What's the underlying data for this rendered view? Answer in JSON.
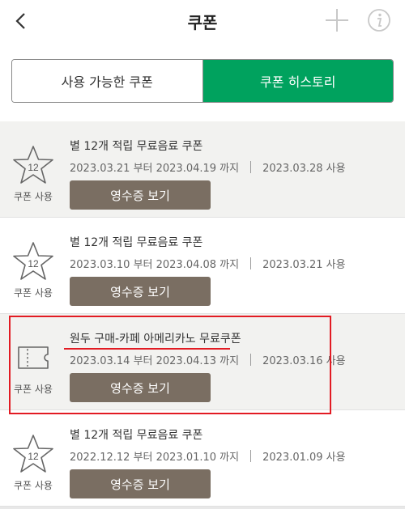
{
  "header": {
    "title": "쿠폰",
    "back_icon": "chevron-left-icon",
    "add_icon": "plus-icon",
    "info_icon": "info-icon"
  },
  "tabs": [
    {
      "label": "사용 가능한 쿠폰",
      "active": false
    },
    {
      "label": "쿠폰 히스토리",
      "active": true
    }
  ],
  "colors": {
    "accent": "#00a25e",
    "receipt_button": "#7a6e62",
    "highlight": "#e21b23"
  },
  "coupons": [
    {
      "title": "별 12개 적립 무료음료 쿠폰",
      "period": "2023.03.21 부터 2023.04.19 까지",
      "used": "2023.03.28 사용",
      "status": "쿠폰 사용",
      "icon": "star-12-icon",
      "icon_text": "12",
      "button": "영수증 보기"
    },
    {
      "title": "별 12개 적립 무료음료 쿠폰",
      "period": "2023.03.10 부터 2023.04.08 까지",
      "used": "2023.03.21 사용",
      "status": "쿠폰 사용",
      "icon": "star-12-icon",
      "icon_text": "12",
      "button": "영수증 보기"
    },
    {
      "title": "원두 구매-카페 아메리카노 무료쿠폰",
      "period": "2023.03.14 부터 2023.04.13 까지",
      "used": "2023.03.16 사용",
      "status": "쿠폰 사용",
      "icon": "ticket-icon",
      "button": "영수증 보기"
    },
    {
      "title": "별 12개 적립 무료음료 쿠폰",
      "period": "2022.12.12 부터 2023.01.10 까지",
      "used": "2023.01.09 사용",
      "status": "쿠폰 사용",
      "icon": "star-12-icon",
      "icon_text": "12",
      "button": "영수증 보기"
    }
  ]
}
